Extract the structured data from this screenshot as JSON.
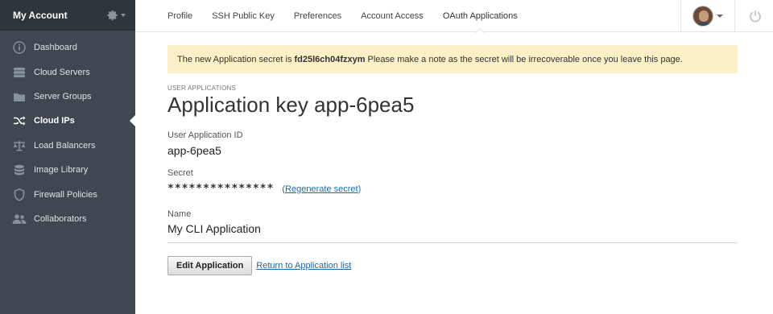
{
  "sidebar": {
    "title": "My Account",
    "items": [
      {
        "label": "Dashboard",
        "icon": "info-icon"
      },
      {
        "label": "Cloud Servers",
        "icon": "servers-icon"
      },
      {
        "label": "Server Groups",
        "icon": "folder-icon"
      },
      {
        "label": "Cloud IPs",
        "icon": "shuffle-icon",
        "active": true
      },
      {
        "label": "Load Balancers",
        "icon": "balance-icon"
      },
      {
        "label": "Image Library",
        "icon": "database-icon"
      },
      {
        "label": "Firewall Policies",
        "icon": "shield-icon"
      },
      {
        "label": "Collaborators",
        "icon": "users-icon"
      }
    ]
  },
  "tabs": [
    "Profile",
    "SSH Public Key",
    "Preferences",
    "Account Access",
    "OAuth Applications"
  ],
  "active_tab": "OAuth Applications",
  "notice": {
    "prefix": "The new Application secret is",
    "secret": "fd25l6ch04fzxym",
    "suffix": "Please make a note as the secret will be irrecoverable once you leave this page."
  },
  "page": {
    "eyebrow": "USER APPLICATIONS",
    "title": "Application key app-6pea5",
    "app_id_label": "User Application ID",
    "app_id": "app-6pea5",
    "secret_label": "Secret",
    "secret_mask": "***************",
    "regen_open": "(",
    "regen_link": "Regenerate secret",
    "regen_close": ")",
    "name_label": "Name",
    "name": "My CLI Application",
    "edit_button": "Edit Application",
    "return_link": "Return to Application list"
  },
  "colors": {
    "sidebar_bg": "#3f4850",
    "notice_bg": "#fcf0c7",
    "link": "#1a6aa8"
  }
}
